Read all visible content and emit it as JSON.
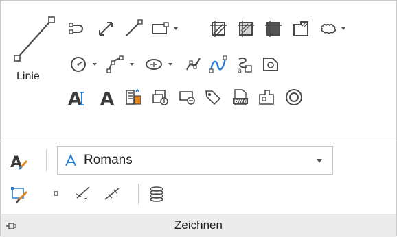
{
  "ribbon": {
    "big_button_label": "Linie",
    "style_dropdown": {
      "value": "Romans"
    },
    "panel_title": "Zeichnen"
  },
  "icons": [
    "line-icon",
    "polyline-icon",
    "dimension-line-icon",
    "construction-line-icon",
    "rectangle-icon",
    "hatch-icon",
    "gradient-hatch-icon",
    "solid-fill-icon",
    "boundary-icon",
    "cloud-icon",
    "circle-icon",
    "arc-icon",
    "ellipse-icon",
    "spline-icon",
    "freehand-spline-icon",
    "helix-text-icon",
    "region-icon",
    "text-icon",
    "mtext-icon",
    "field-icon",
    "block-insert-icon",
    "block-edit-icon",
    "tag-icon",
    "dwg-reference-icon",
    "wipeout-icon",
    "donut-icon",
    "text-style-icon",
    "match-properties-icon",
    "point-icon",
    "divide-icon",
    "measure-icon",
    "revision-icon",
    "pin-icon"
  ],
  "colors": {
    "panel_bg": "#ffffff",
    "footer_bg": "#ececec",
    "icon_dark": "#4a4a4a",
    "icon_blue": "#2b7cd3",
    "icon_orange": "#e8821a"
  }
}
